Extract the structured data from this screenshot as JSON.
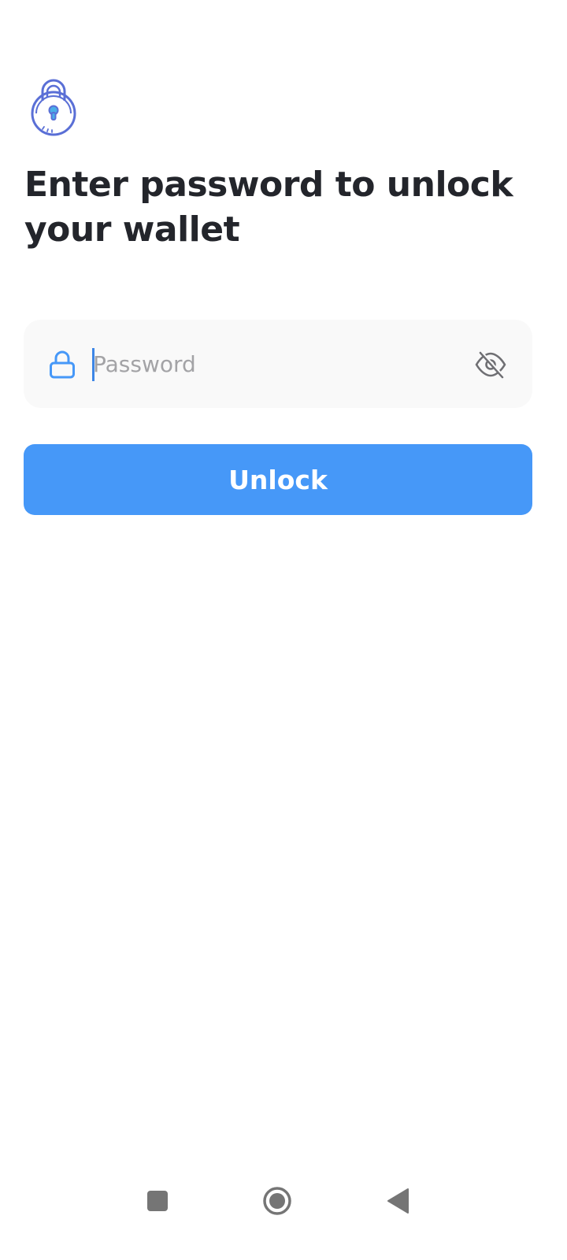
{
  "page": {
    "title": "Enter password to unlock your wallet"
  },
  "password_field": {
    "placeholder": "Password",
    "value": ""
  },
  "unlock_button": {
    "label": "Unlock"
  },
  "icons": {
    "illustration": "padlock-icon",
    "field_prefix": "lock-icon",
    "toggle_visibility": "eye-off-icon",
    "nav_recents": "square-icon",
    "nav_home": "circle-icon",
    "nav_back": "triangle-back-icon"
  },
  "colors": {
    "primary": "#4698f8",
    "title_text": "#23252b",
    "field_background": "#f9f9f9",
    "placeholder_text": "#a3a3a6",
    "illustration_stroke": "#5a6fd6",
    "illustration_keyhole": "#4aaee8"
  }
}
